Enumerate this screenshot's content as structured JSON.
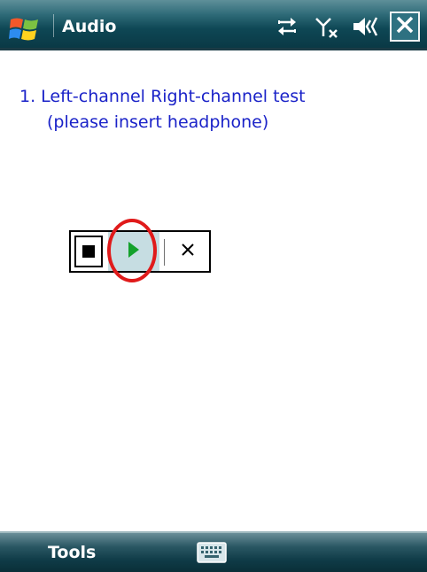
{
  "titlebar": {
    "app_title": "Audio",
    "status_icons": [
      "sync-arrows-icon",
      "no-signal-icon",
      "speaker-icon"
    ],
    "close_icon": "close-icon"
  },
  "content": {
    "instruction_line1": "1. Left-channel Right-channel test",
    "instruction_line2": "(please insert headphone)",
    "media_controls": {
      "stop_icon": "stop-icon",
      "play_icon": "play-icon",
      "cancel_label": "×",
      "highlighted": "play-button",
      "highlight_color": "#e01a1a"
    }
  },
  "softkeys": {
    "left_label": "Tools",
    "center_icon": "keyboard-icon"
  },
  "colors": {
    "text_blue": "#1a22c8",
    "title_bar": "#0e4755",
    "play_green": "#13a12b"
  }
}
